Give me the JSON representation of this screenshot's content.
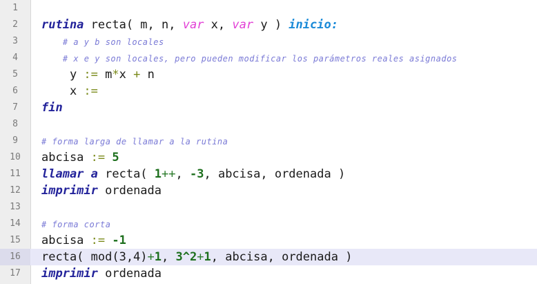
{
  "editor": {
    "lines": [
      {
        "n": "1",
        "tokens": []
      },
      {
        "n": "2",
        "tokens": [
          {
            "t": "rutina",
            "c": "kw"
          },
          {
            "t": " recta( m, n, ",
            "c": ""
          },
          {
            "t": "var",
            "c": "var"
          },
          {
            "t": " x, ",
            "c": ""
          },
          {
            "t": "var",
            "c": "var"
          },
          {
            "t": " y ) ",
            "c": ""
          },
          {
            "t": "inicio:",
            "c": "kw2"
          }
        ]
      },
      {
        "n": "3",
        "tokens": [
          {
            "t": "    # a y b son locales",
            "c": "cm"
          }
        ]
      },
      {
        "n": "4",
        "tokens": [
          {
            "t": "    # x e y son locales, pero pueden modificar los parámetros reales asignados",
            "c": "cm"
          }
        ]
      },
      {
        "n": "5",
        "tokens": [
          {
            "t": "    y ",
            "c": ""
          },
          {
            "t": ":=",
            "c": "op"
          },
          {
            "t": " m",
            "c": ""
          },
          {
            "t": "*",
            "c": "op"
          },
          {
            "t": "x ",
            "c": ""
          },
          {
            "t": "+",
            "c": "op"
          },
          {
            "t": " n",
            "c": ""
          }
        ]
      },
      {
        "n": "6",
        "tokens": [
          {
            "t": "    x ",
            "c": ""
          },
          {
            "t": ":=",
            "c": "op"
          }
        ]
      },
      {
        "n": "7",
        "tokens": [
          {
            "t": "fin",
            "c": "kw"
          }
        ]
      },
      {
        "n": "8",
        "tokens": []
      },
      {
        "n": "9",
        "tokens": [
          {
            "t": "# forma larga de llamar a la rutina",
            "c": "cm"
          }
        ]
      },
      {
        "n": "10",
        "tokens": [
          {
            "t": "abcisa ",
            "c": ""
          },
          {
            "t": ":=",
            "c": "op"
          },
          {
            "t": " ",
            "c": ""
          },
          {
            "t": "5",
            "c": "num"
          }
        ]
      },
      {
        "n": "11",
        "tokens": [
          {
            "t": "llamar a",
            "c": "kw"
          },
          {
            "t": " recta( ",
            "c": ""
          },
          {
            "t": "1",
            "c": "num"
          },
          {
            "t": "++",
            "c": "op2"
          },
          {
            "t": ", ",
            "c": ""
          },
          {
            "t": "-3",
            "c": "num"
          },
          {
            "t": ", abcisa, ordenada )",
            "c": ""
          }
        ]
      },
      {
        "n": "12",
        "tokens": [
          {
            "t": "imprimir",
            "c": "kw"
          },
          {
            "t": " ordenada",
            "c": ""
          }
        ]
      },
      {
        "n": "13",
        "tokens": []
      },
      {
        "n": "14",
        "tokens": [
          {
            "t": "# forma corta",
            "c": "cm"
          }
        ]
      },
      {
        "n": "15",
        "tokens": [
          {
            "t": "abcisa ",
            "c": ""
          },
          {
            "t": ":=",
            "c": "op"
          },
          {
            "t": " ",
            "c": ""
          },
          {
            "t": "-1",
            "c": "num"
          }
        ]
      },
      {
        "n": "16",
        "current": true,
        "tokens": [
          {
            "t": "recta( mod(3,4)",
            "c": ""
          },
          {
            "t": "+",
            "c": "op2"
          },
          {
            "t": "1",
            "c": "num"
          },
          {
            "t": ", ",
            "c": ""
          },
          {
            "t": "3^2",
            "c": "num"
          },
          {
            "t": "+",
            "c": "op2"
          },
          {
            "t": "1",
            "c": "num"
          },
          {
            "t": ", abcisa, ordenada )",
            "c": ""
          }
        ]
      },
      {
        "n": "17",
        "tokens": [
          {
            "t": "imprimir",
            "c": "kw"
          },
          {
            "t": " ordenada",
            "c": ""
          }
        ]
      }
    ]
  },
  "colors": {
    "keyword": "#22229a",
    "keyword_alt": "#1a8ad8",
    "var_keyword": "#e23fd6",
    "number": "#1d6f1d",
    "operator": "#7a8a1a",
    "comment": "#7a7ad6",
    "current_line": "#e8e8f8",
    "gutter": "#eeeeee"
  }
}
